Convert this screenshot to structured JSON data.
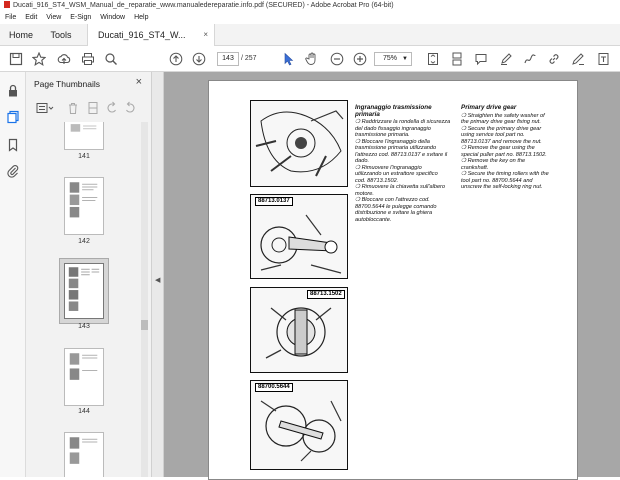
{
  "window": {
    "title": "Ducati_916_ST4_WSM_Manual_de_reparatie_www.manualedereparatie.info.pdf (SECURED) - Adobe Acrobat Pro (64-bit)"
  },
  "menu": [
    "File",
    "Edit",
    "View",
    "E-Sign",
    "Window",
    "Help"
  ],
  "tabs": {
    "home": "Home",
    "tools": "Tools",
    "doc": "Ducati_916_ST4_W...",
    "doc_close": "×"
  },
  "toolbar": {
    "page_current": "143",
    "page_total": "/ 257",
    "zoom": "75%"
  },
  "panel": {
    "title": "Page Thumbnails",
    "close": "×",
    "thumbs": [
      {
        "label": "141"
      },
      {
        "label": "142"
      },
      {
        "label": "143",
        "selected": true
      },
      {
        "label": "144"
      }
    ]
  },
  "document": {
    "italian": {
      "heading": "Ingranaggio trasmissione primaria",
      "lines": [
        "❍ Raddrizzare la rondella di sicurezza",
        "del dado fissaggio ingranaggio",
        "trasmissione primaria.",
        "❍ Bloccare l'ingranaggio della",
        "trasmissione primaria utilizzando",
        "l'attrezzo cod. 88713.0137 e svitare il",
        "dado.",
        "❍ Rimuovere l'ingranaggio",
        "utilizzando un estrattore specifico",
        "cod. 88713.1502.",
        "❍ Rimuovere la chiavetta sull'albero",
        "motore.",
        "❍ Bloccare con l'attrezzo cod.",
        "88700.5644 le pulegge comando",
        "distribuzione e svitare la ghiera",
        "autobloccante."
      ]
    },
    "english": {
      "heading": "Primary drive gear",
      "lines": [
        "❍ Straighten the safety washer of",
        "the primary drive gear fixing nut.",
        "❍ Secure the primary drive gear",
        "using service tool part no.",
        "88713.0137 and remove the nut.",
        "❍ Remove the gear using the",
        "special puller part no. 88713.1502.",
        "❍ Remove the key on the",
        "crankshaft.",
        "❍ Secure the timing rollers with the",
        "tool part no. 88700.5644 and",
        "unscrew the self-locking ring nut."
      ]
    },
    "tool_tags": [
      "88713.0137",
      "88713.1502",
      "88700.5644"
    ]
  }
}
